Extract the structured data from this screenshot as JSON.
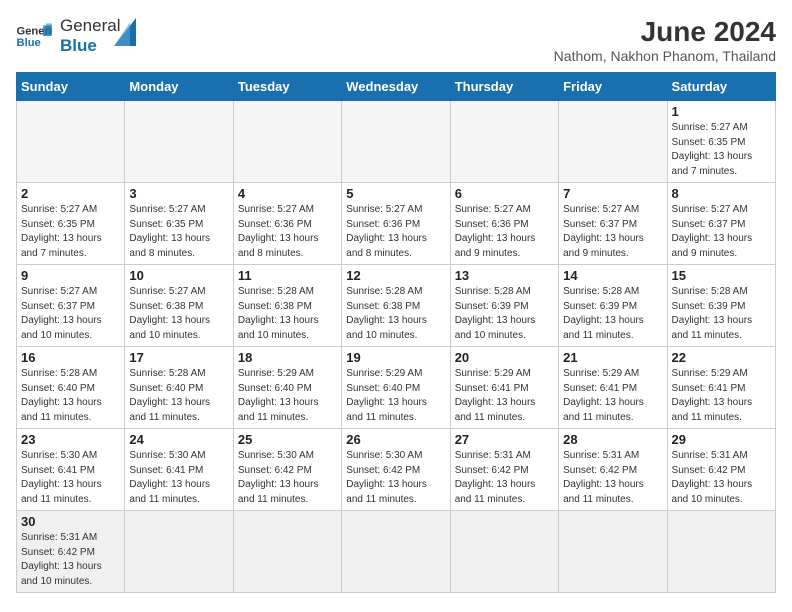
{
  "logo": {
    "text_general": "General",
    "text_blue": "Blue"
  },
  "title": "June 2024",
  "location": "Nathom, Nakhon Phanom, Thailand",
  "weekdays": [
    "Sunday",
    "Monday",
    "Tuesday",
    "Wednesday",
    "Thursday",
    "Friday",
    "Saturday"
  ],
  "days": [
    {
      "num": "",
      "info": ""
    },
    {
      "num": "",
      "info": ""
    },
    {
      "num": "",
      "info": ""
    },
    {
      "num": "",
      "info": ""
    },
    {
      "num": "",
      "info": ""
    },
    {
      "num": "",
      "info": ""
    },
    {
      "num": "1",
      "info": "Sunrise: 5:27 AM\nSunset: 6:35 PM\nDaylight: 13 hours and 7 minutes."
    },
    {
      "num": "2",
      "info": "Sunrise: 5:27 AM\nSunset: 6:35 PM\nDaylight: 13 hours and 7 minutes."
    },
    {
      "num": "3",
      "info": "Sunrise: 5:27 AM\nSunset: 6:35 PM\nDaylight: 13 hours and 8 minutes."
    },
    {
      "num": "4",
      "info": "Sunrise: 5:27 AM\nSunset: 6:36 PM\nDaylight: 13 hours and 8 minutes."
    },
    {
      "num": "5",
      "info": "Sunrise: 5:27 AM\nSunset: 6:36 PM\nDaylight: 13 hours and 8 minutes."
    },
    {
      "num": "6",
      "info": "Sunrise: 5:27 AM\nSunset: 6:36 PM\nDaylight: 13 hours and 9 minutes."
    },
    {
      "num": "7",
      "info": "Sunrise: 5:27 AM\nSunset: 6:37 PM\nDaylight: 13 hours and 9 minutes."
    },
    {
      "num": "8",
      "info": "Sunrise: 5:27 AM\nSunset: 6:37 PM\nDaylight: 13 hours and 9 minutes."
    },
    {
      "num": "9",
      "info": "Sunrise: 5:27 AM\nSunset: 6:37 PM\nDaylight: 13 hours and 10 minutes."
    },
    {
      "num": "10",
      "info": "Sunrise: 5:27 AM\nSunset: 6:38 PM\nDaylight: 13 hours and 10 minutes."
    },
    {
      "num": "11",
      "info": "Sunrise: 5:28 AM\nSunset: 6:38 PM\nDaylight: 13 hours and 10 minutes."
    },
    {
      "num": "12",
      "info": "Sunrise: 5:28 AM\nSunset: 6:38 PM\nDaylight: 13 hours and 10 minutes."
    },
    {
      "num": "13",
      "info": "Sunrise: 5:28 AM\nSunset: 6:39 PM\nDaylight: 13 hours and 10 minutes."
    },
    {
      "num": "14",
      "info": "Sunrise: 5:28 AM\nSunset: 6:39 PM\nDaylight: 13 hours and 11 minutes."
    },
    {
      "num": "15",
      "info": "Sunrise: 5:28 AM\nSunset: 6:39 PM\nDaylight: 13 hours and 11 minutes."
    },
    {
      "num": "16",
      "info": "Sunrise: 5:28 AM\nSunset: 6:40 PM\nDaylight: 13 hours and 11 minutes."
    },
    {
      "num": "17",
      "info": "Sunrise: 5:28 AM\nSunset: 6:40 PM\nDaylight: 13 hours and 11 minutes."
    },
    {
      "num": "18",
      "info": "Sunrise: 5:29 AM\nSunset: 6:40 PM\nDaylight: 13 hours and 11 minutes."
    },
    {
      "num": "19",
      "info": "Sunrise: 5:29 AM\nSunset: 6:40 PM\nDaylight: 13 hours and 11 minutes."
    },
    {
      "num": "20",
      "info": "Sunrise: 5:29 AM\nSunset: 6:41 PM\nDaylight: 13 hours and 11 minutes."
    },
    {
      "num": "21",
      "info": "Sunrise: 5:29 AM\nSunset: 6:41 PM\nDaylight: 13 hours and 11 minutes."
    },
    {
      "num": "22",
      "info": "Sunrise: 5:29 AM\nSunset: 6:41 PM\nDaylight: 13 hours and 11 minutes."
    },
    {
      "num": "23",
      "info": "Sunrise: 5:30 AM\nSunset: 6:41 PM\nDaylight: 13 hours and 11 minutes."
    },
    {
      "num": "24",
      "info": "Sunrise: 5:30 AM\nSunset: 6:41 PM\nDaylight: 13 hours and 11 minutes."
    },
    {
      "num": "25",
      "info": "Sunrise: 5:30 AM\nSunset: 6:42 PM\nDaylight: 13 hours and 11 minutes."
    },
    {
      "num": "26",
      "info": "Sunrise: 5:30 AM\nSunset: 6:42 PM\nDaylight: 13 hours and 11 minutes."
    },
    {
      "num": "27",
      "info": "Sunrise: 5:31 AM\nSunset: 6:42 PM\nDaylight: 13 hours and 11 minutes."
    },
    {
      "num": "28",
      "info": "Sunrise: 5:31 AM\nSunset: 6:42 PM\nDaylight: 13 hours and 11 minutes."
    },
    {
      "num": "29",
      "info": "Sunrise: 5:31 AM\nSunset: 6:42 PM\nDaylight: 13 hours and 10 minutes."
    },
    {
      "num": "30",
      "info": "Sunrise: 5:31 AM\nSunset: 6:42 PM\nDaylight: 13 hours and 10 minutes."
    },
    {
      "num": "",
      "info": ""
    },
    {
      "num": "",
      "info": ""
    },
    {
      "num": "",
      "info": ""
    },
    {
      "num": "",
      "info": ""
    },
    {
      "num": "",
      "info": ""
    },
    {
      "num": "",
      "info": ""
    }
  ]
}
